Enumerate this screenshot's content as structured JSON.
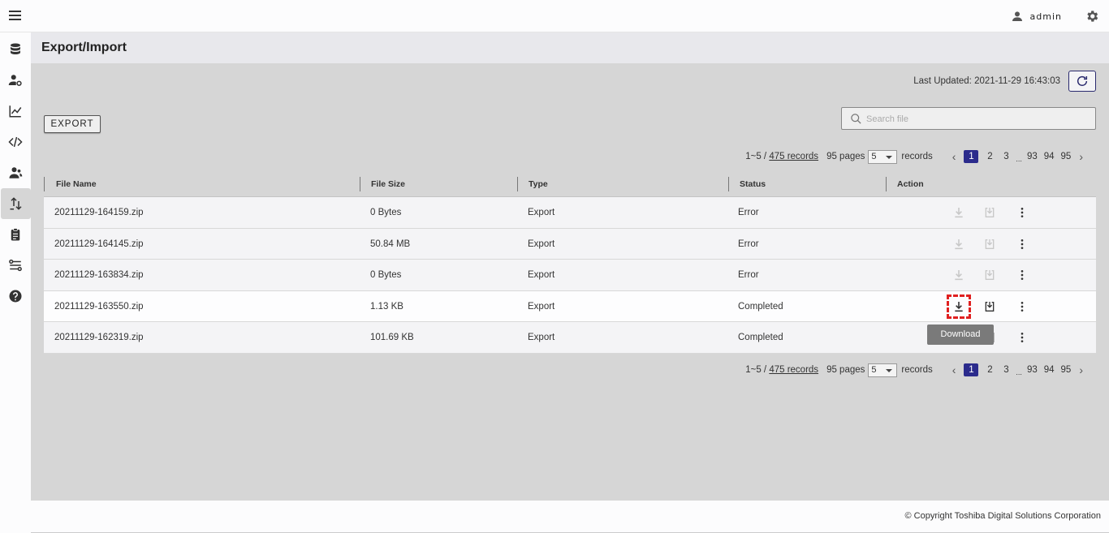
{
  "user": {
    "name": "admin"
  },
  "page": {
    "title": "Export/Import",
    "last_updated": "Last Updated: 2021-11-29 16:43:03"
  },
  "toolbar": {
    "export_label": "EXPORT",
    "search_placeholder": "Search file"
  },
  "pagination": {
    "range": "1~5 / ",
    "records_link": "475 records",
    "pages_label": "95 pages",
    "per_page": "5",
    "records_label": "records",
    "pages": [
      "1",
      "2",
      "3",
      "93",
      "94",
      "95"
    ],
    "ellipsis": "...",
    "current_page": "1"
  },
  "table": {
    "columns": [
      "File Name",
      "File Size",
      "Type",
      "Status",
      "Action"
    ],
    "rows": [
      {
        "file": "20211129-164159.zip",
        "size": "0 Bytes",
        "type": "Export",
        "status": "Error"
      },
      {
        "file": "20211129-164145.zip",
        "size": "50.84 MB",
        "type": "Export",
        "status": "Error"
      },
      {
        "file": "20211129-163834.zip",
        "size": "0 Bytes",
        "type": "Export",
        "status": "Error"
      },
      {
        "file": "20211129-163550.zip",
        "size": "1.13 KB",
        "type": "Export",
        "status": "Completed"
      },
      {
        "file": "20211129-162319.zip",
        "size": "101.69 KB",
        "type": "Export",
        "status": "Completed"
      }
    ]
  },
  "tooltip": {
    "text": "Download"
  },
  "footer": {
    "copyright": "© Copyright Toshiba Digital Solutions Corporation"
  },
  "sidebar": {
    "icons": [
      "database-icon",
      "user-settings-icon",
      "chart-line-icon",
      "code-icon",
      "users-icon",
      "import-export-icon",
      "clipboard-icon",
      "settings-flow-icon",
      "help-icon"
    ],
    "active": "import-export-icon"
  },
  "colors": {
    "accent": "#2b2b8c",
    "disabled": "#c8c8c8",
    "focus": "#e02020"
  }
}
